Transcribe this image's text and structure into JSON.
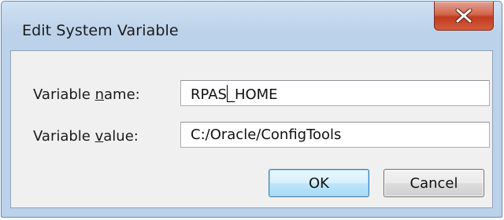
{
  "dialog": {
    "title": "Edit System Variable",
    "close_icon": "close-x-icon"
  },
  "form": {
    "name_label_prefix": "Variable ",
    "name_label_accel": "n",
    "name_label_rest": "ame:",
    "name_value_before_caret": "RPAS",
    "name_value_after_caret": "_HOME",
    "value_label_prefix": "Variable ",
    "value_label_accel": "v",
    "value_label_rest": "alue:",
    "value_value": "C:/Oracle/ConfigTools"
  },
  "buttons": {
    "ok_label": "OK",
    "cancel_label": "Cancel"
  },
  "colors": {
    "close_button": "#c23b1f",
    "frame": "#bcd2ea",
    "client": "#f0f0f0",
    "default_button_border": "#3c7fb1"
  }
}
